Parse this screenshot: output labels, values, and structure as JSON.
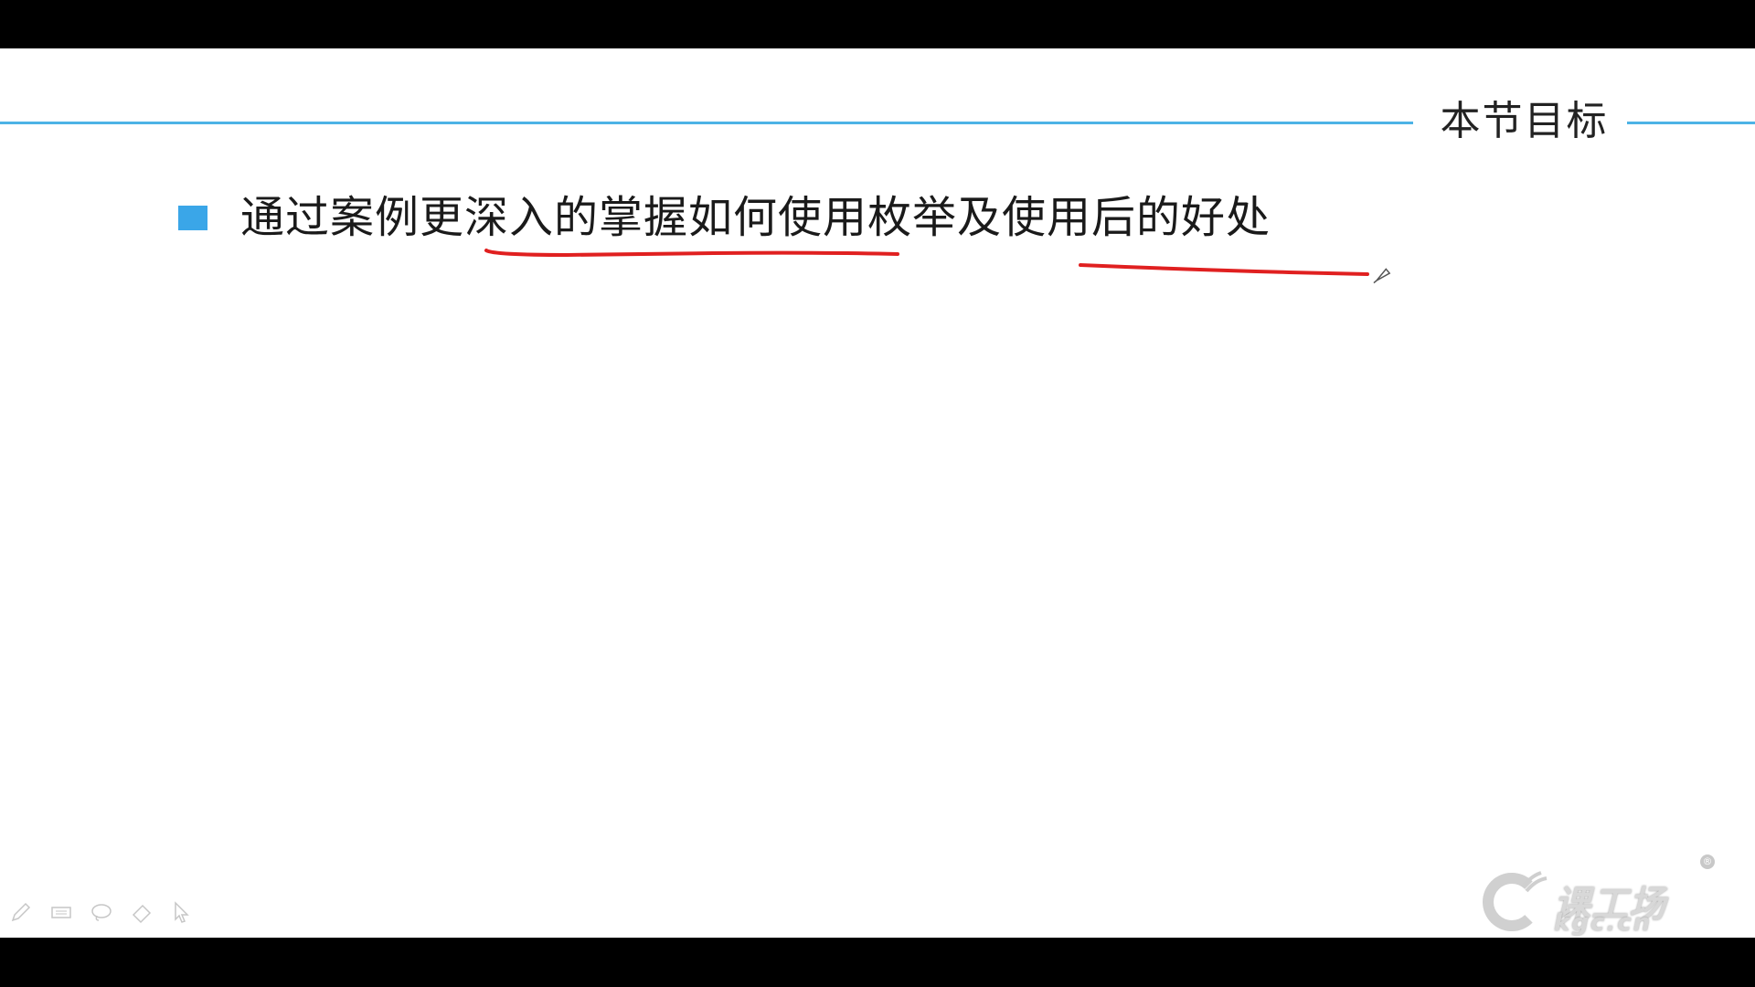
{
  "slide": {
    "title": "本节目标",
    "bullets": [
      {
        "text": "通过案例更深入的掌握如何使用枚举及使用后的好处"
      }
    ]
  },
  "colors": {
    "accent_line": "#4db3e6",
    "bullet": "#3aa6e8",
    "annotation_pen": "#e02020",
    "frame": "#000000"
  },
  "toolbar": {
    "tools": [
      "pen-icon",
      "highlighter-icon",
      "lasso-icon",
      "eraser-icon",
      "pointer-icon"
    ]
  },
  "logo": {
    "brand_cn": "课工场",
    "brand_en": "kgc.cn",
    "registered_mark": "®"
  }
}
